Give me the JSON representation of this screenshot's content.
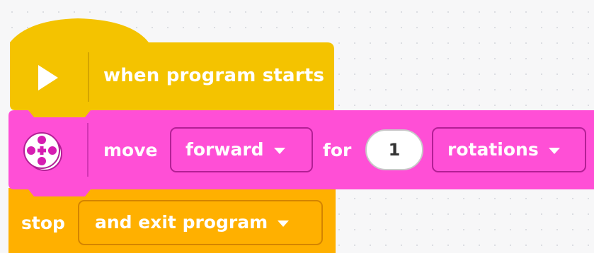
{
  "colors": {
    "canvas_background": "#f7f7f8",
    "event_block": "#f4c300",
    "motion_block": "#ff4fd6",
    "control_block": "#ffb000",
    "text": "#ffffff"
  },
  "blocks": {
    "hat": {
      "icon": "play-icon",
      "label": "when program starts"
    },
    "move": {
      "icon": "motor-icon",
      "label": "move",
      "direction": "forward",
      "for_label": "for",
      "amount": "1",
      "unit": "rotations"
    },
    "stop": {
      "label": "stop",
      "option": "and exit program"
    }
  }
}
